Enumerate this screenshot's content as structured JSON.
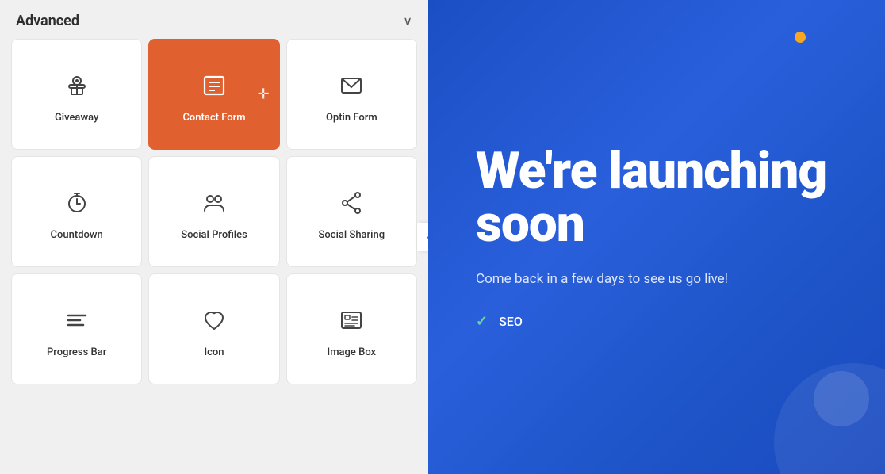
{
  "panel": {
    "title": "Advanced",
    "chevron": "∨",
    "collapse_arrow": "‹"
  },
  "grid_items": [
    {
      "id": "giveaway",
      "label": "Giveaway",
      "icon": "gift",
      "active": false
    },
    {
      "id": "contact-form",
      "label": "Contact Form",
      "icon": "form",
      "active": true
    },
    {
      "id": "optin-form",
      "label": "Optin Form",
      "icon": "email",
      "active": false
    },
    {
      "id": "countdown",
      "label": "Countdown",
      "icon": "timer",
      "active": false
    },
    {
      "id": "social-profiles",
      "label": "Social Profiles",
      "icon": "people",
      "active": false
    },
    {
      "id": "social-sharing",
      "label": "Social Sharing",
      "icon": "share",
      "active": false
    },
    {
      "id": "progress-bar",
      "label": "Progress Bar",
      "icon": "bars",
      "active": false
    },
    {
      "id": "icon",
      "label": "Icon",
      "icon": "heart",
      "active": false
    },
    {
      "id": "image-box",
      "label": "Image Box",
      "icon": "image",
      "active": false
    }
  ],
  "right": {
    "heading": "We're launching soon",
    "subtext": "Come back in a few days to see us go live!",
    "features": [
      "SEO",
      ""
    ]
  }
}
